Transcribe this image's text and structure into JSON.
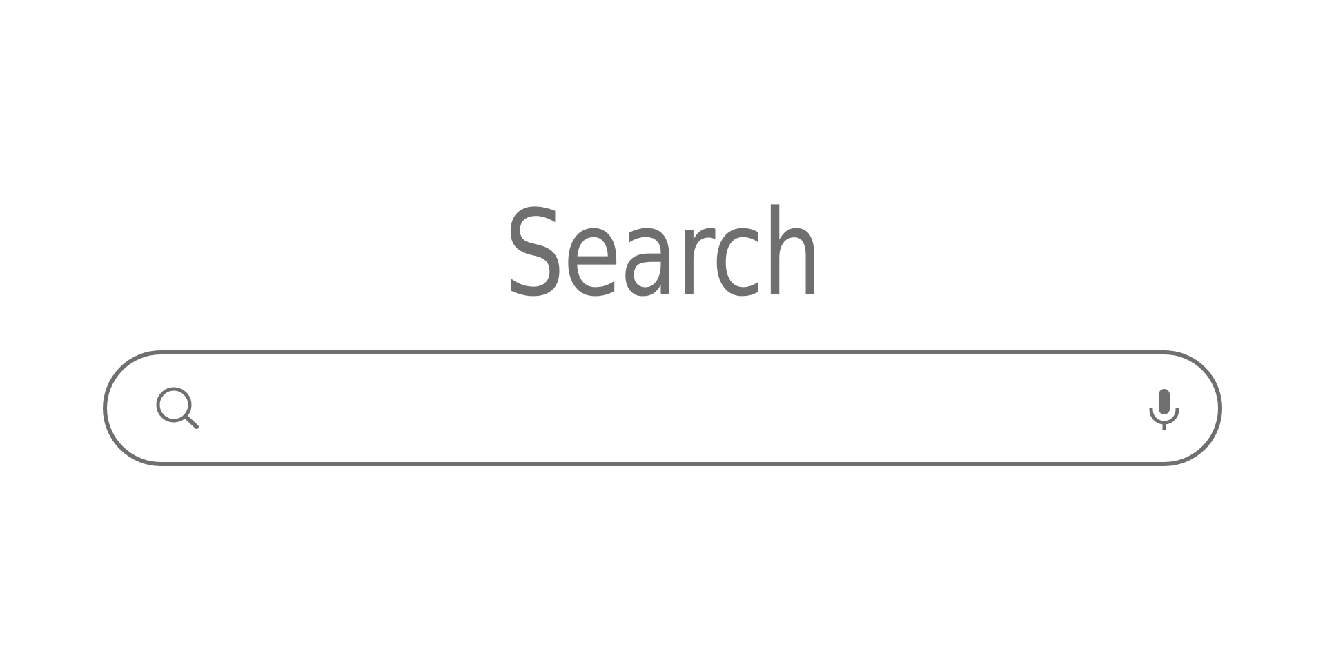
{
  "header": {
    "title": "Search"
  },
  "search": {
    "value": "",
    "placeholder": ""
  },
  "icons": {
    "search": "search-icon",
    "microphone": "microphone-icon"
  },
  "colors": {
    "ink": "#6f6f6f",
    "background": "#ffffff"
  }
}
